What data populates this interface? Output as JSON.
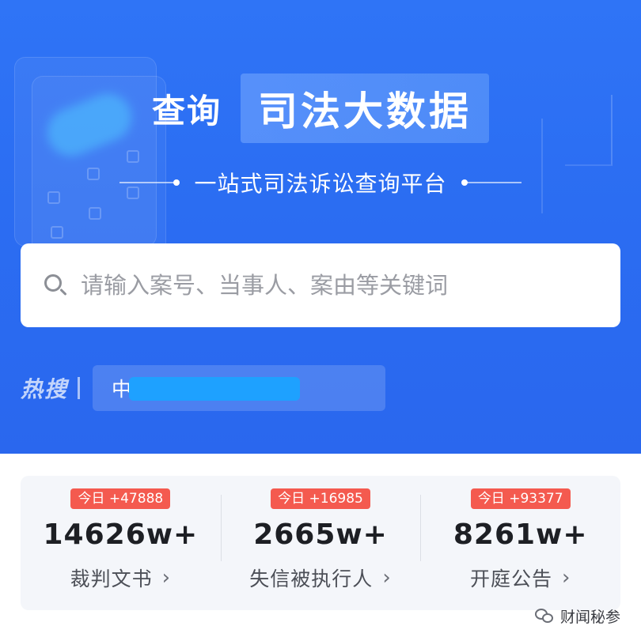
{
  "hero": {
    "title_prefix": "查询",
    "title_main": "司法大数据",
    "subtitle": "一站式司法诉讼查询平台"
  },
  "search": {
    "placeholder": "请输入案号、当事人、案由等关键词",
    "value": ""
  },
  "hot_search": {
    "label": "热搜",
    "item": "中国 限公司"
  },
  "stats": [
    {
      "badge": "今日 +47888",
      "value": "14626w+",
      "label": "裁判文书"
    },
    {
      "badge": "今日 +16985",
      "value": "2665w+",
      "label": "失信被执行人"
    },
    {
      "badge": "今日 +93377",
      "value": "8261w+",
      "label": "开庭公告"
    }
  ],
  "watermark": {
    "text": "财闻秘参",
    "icon": "wechat-icon"
  },
  "colors": {
    "hero_blue": "#2f74f6",
    "badge_red": "#f45a4f",
    "redaction_blue": "#1ea1ff"
  }
}
